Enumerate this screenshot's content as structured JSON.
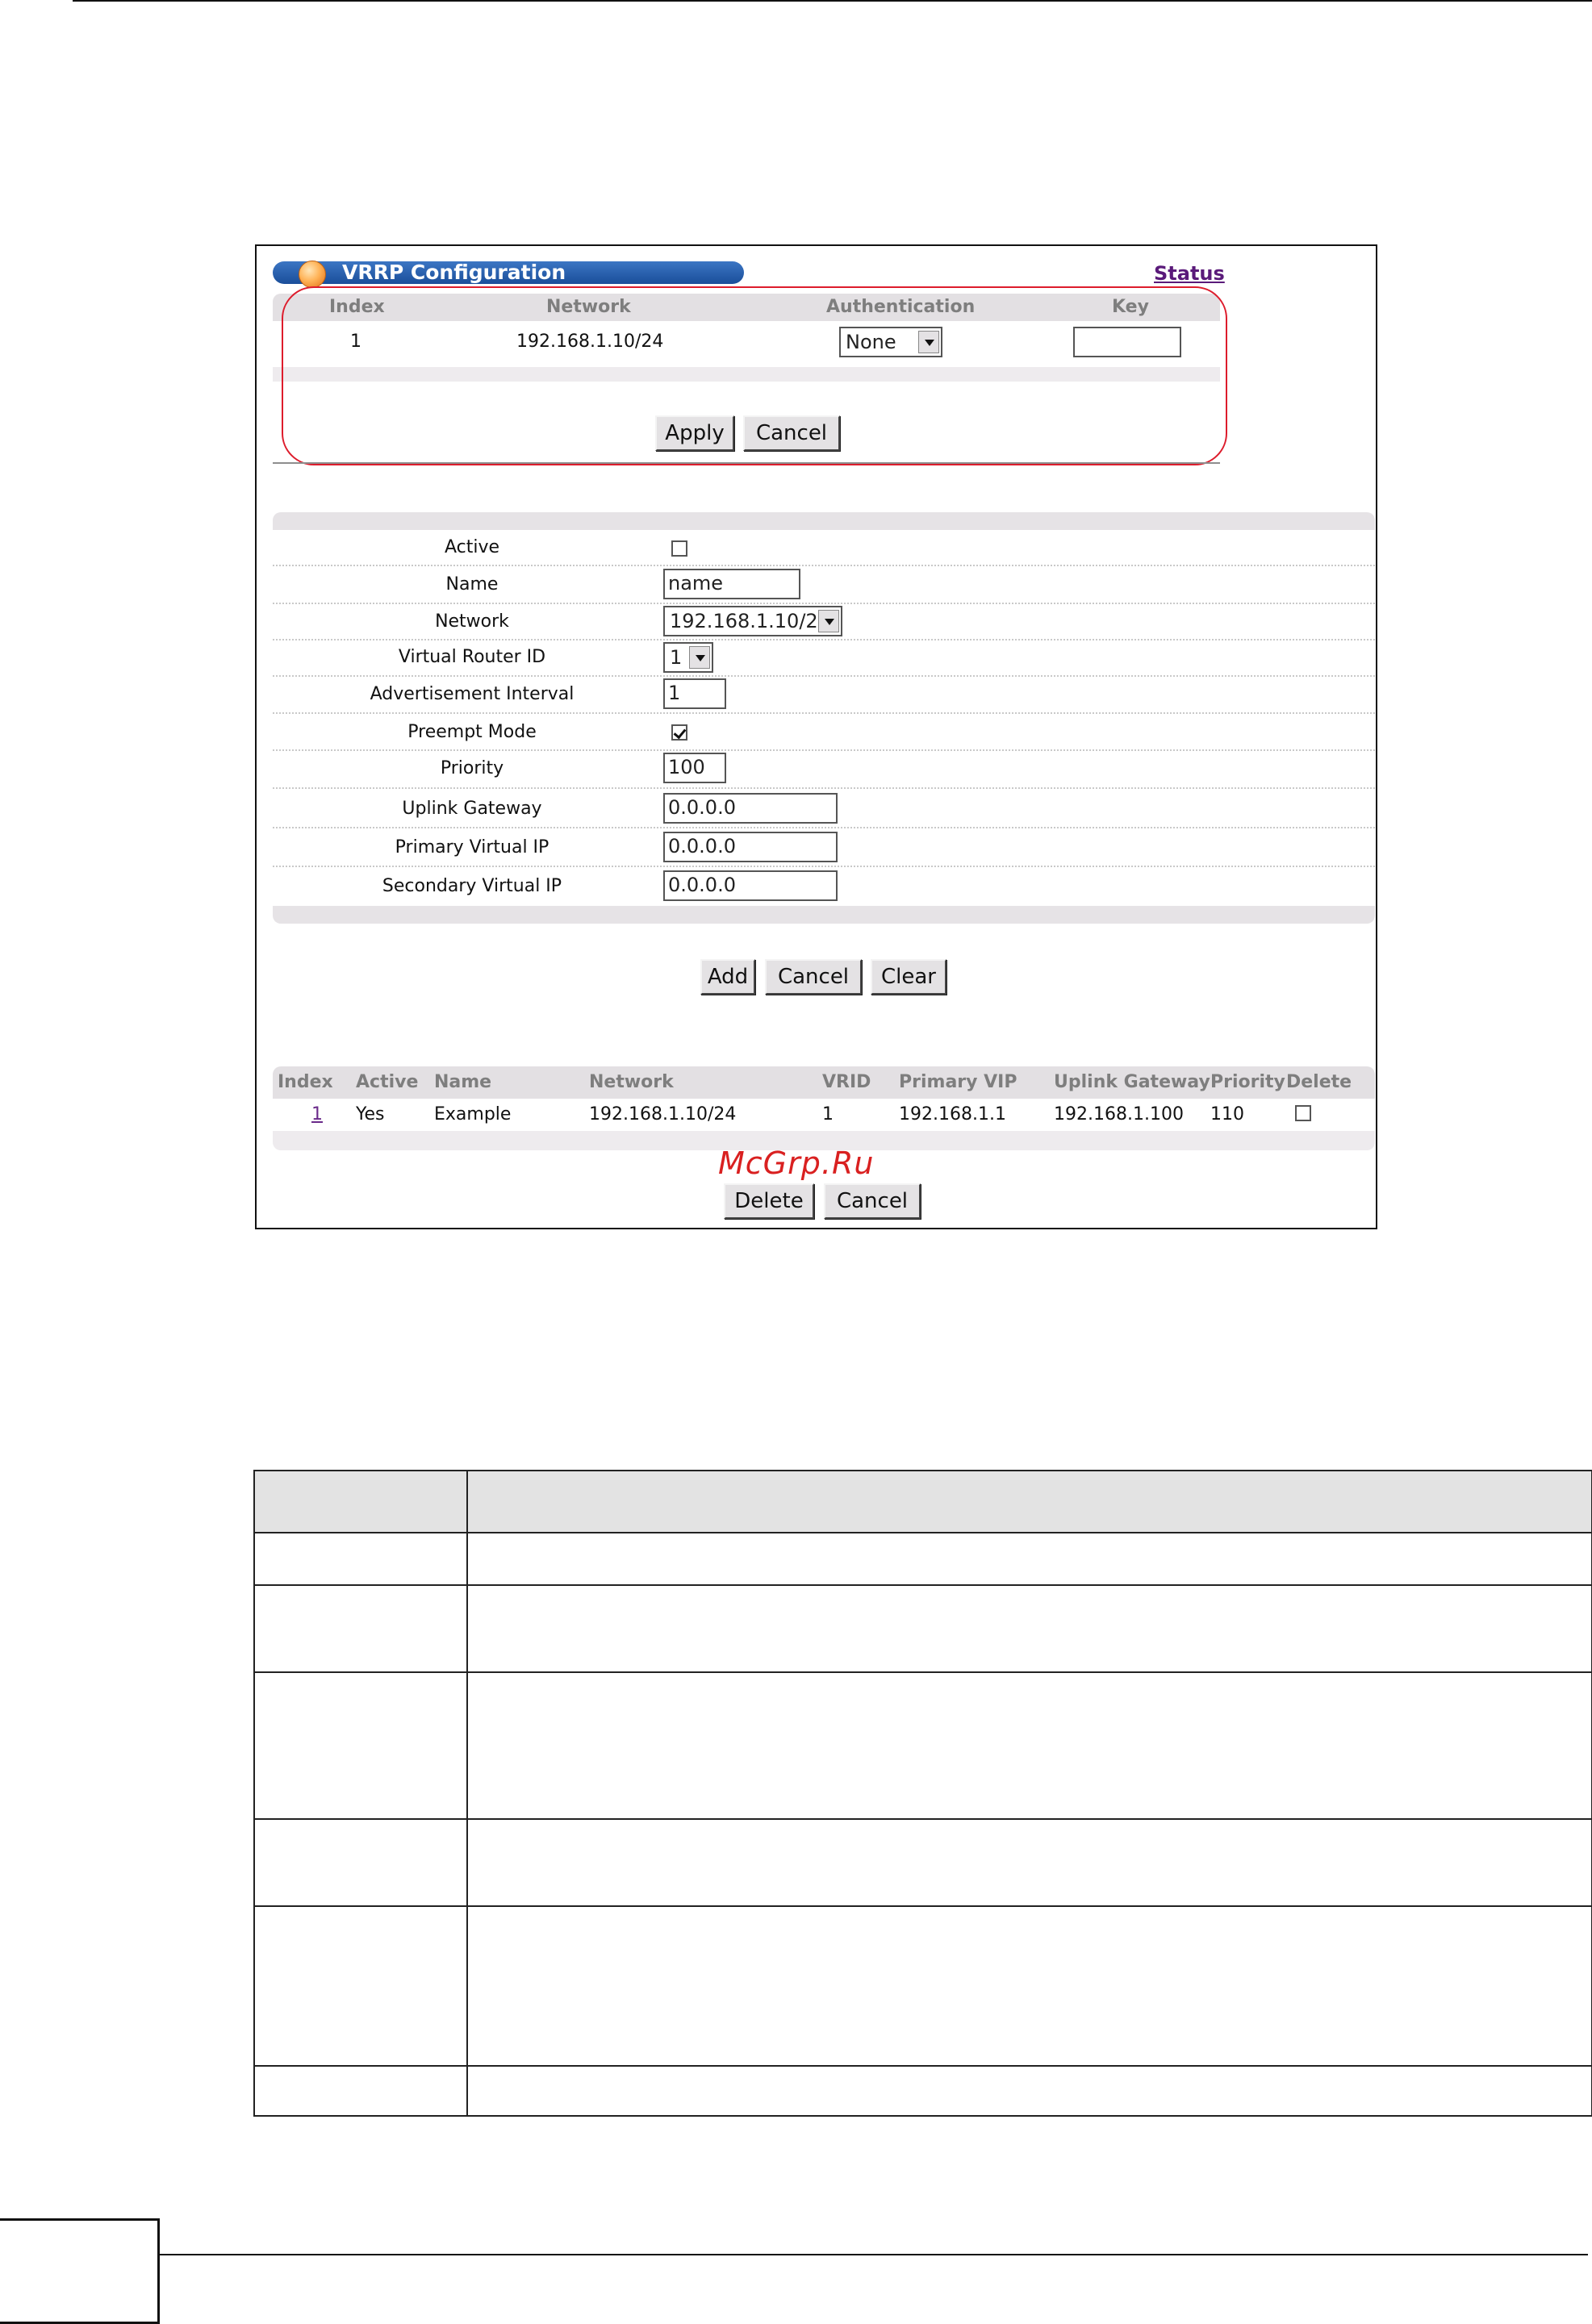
{
  "panel": {
    "title": "VRRP Configuration",
    "status_link": "Status"
  },
  "top_table": {
    "headers": [
      "Index",
      "Network",
      "Authentication",
      "Key"
    ],
    "row": {
      "index": "1",
      "network": "192.168.1.10/24",
      "authentication": "None",
      "key": ""
    },
    "apply_label": "Apply",
    "cancel_label": "Cancel"
  },
  "form": {
    "fields": [
      {
        "label": "Active",
        "type": "checkbox",
        "checked": false
      },
      {
        "label": "Name",
        "type": "text",
        "value": "name"
      },
      {
        "label": "Network",
        "type": "select",
        "value": "192.168.1.10/24"
      },
      {
        "label": "Virtual Router ID",
        "type": "select",
        "value": "1"
      },
      {
        "label": "Advertisement Interval",
        "type": "text",
        "value": "1"
      },
      {
        "label": "Preempt Mode",
        "type": "checkbox",
        "checked": true
      },
      {
        "label": "Priority",
        "type": "text",
        "value": "100"
      },
      {
        "label": "Uplink Gateway",
        "type": "text",
        "value": "0.0.0.0"
      },
      {
        "label": "Primary Virtual IP",
        "type": "text",
        "value": "0.0.0.0"
      },
      {
        "label": "Secondary Virtual IP",
        "type": "text",
        "value": "0.0.0.0"
      }
    ],
    "add_label": "Add",
    "cancel_label": "Cancel",
    "clear_label": "Clear"
  },
  "list": {
    "headers": [
      "Index",
      "Active",
      "Name",
      "Network",
      "VRID",
      "Primary VIP",
      "Uplink Gateway",
      "Priority",
      "Delete"
    ],
    "rows": [
      {
        "index": "1",
        "active": "Yes",
        "name": "Example",
        "network": "192.168.1.10/24",
        "vrid": "1",
        "primary_vip": "192.168.1.1",
        "uplink_gateway": "192.168.1.100",
        "priority": "110",
        "delete": false
      }
    ],
    "delete_label": "Delete",
    "cancel_label": "Cancel"
  },
  "watermark": "McGrp.Ru"
}
